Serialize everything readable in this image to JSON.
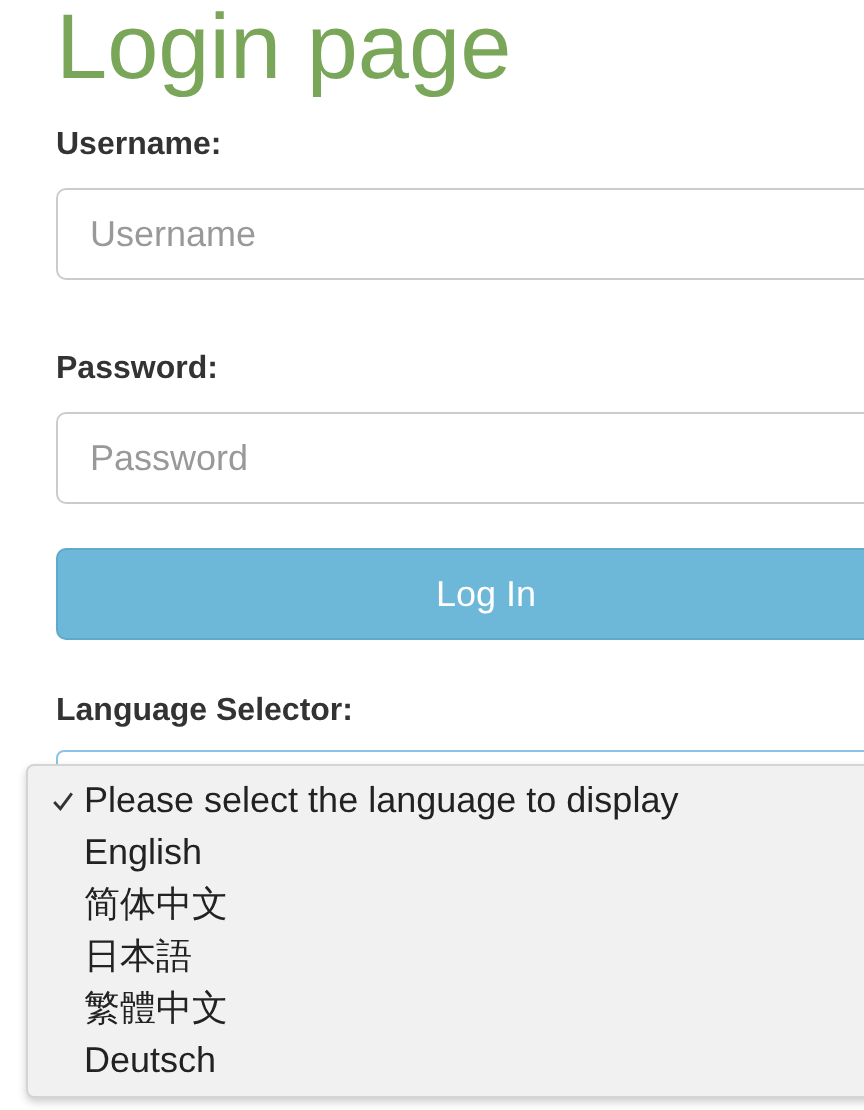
{
  "title": "Login page",
  "fields": [
    {
      "label": "Username:",
      "placeholder": "Username"
    },
    {
      "label": "Password:",
      "placeholder": "Password"
    }
  ],
  "login_button": "Log In",
  "language": {
    "label": "Language Selector:",
    "options": [
      {
        "label": "Please select the language to display",
        "selected": true
      },
      {
        "label": "English",
        "selected": false
      },
      {
        "label": "简体中文",
        "selected": false
      },
      {
        "label": "日本語",
        "selected": false
      },
      {
        "label": "繁體中文",
        "selected": false
      },
      {
        "label": "Deutsch",
        "selected": false
      }
    ]
  }
}
